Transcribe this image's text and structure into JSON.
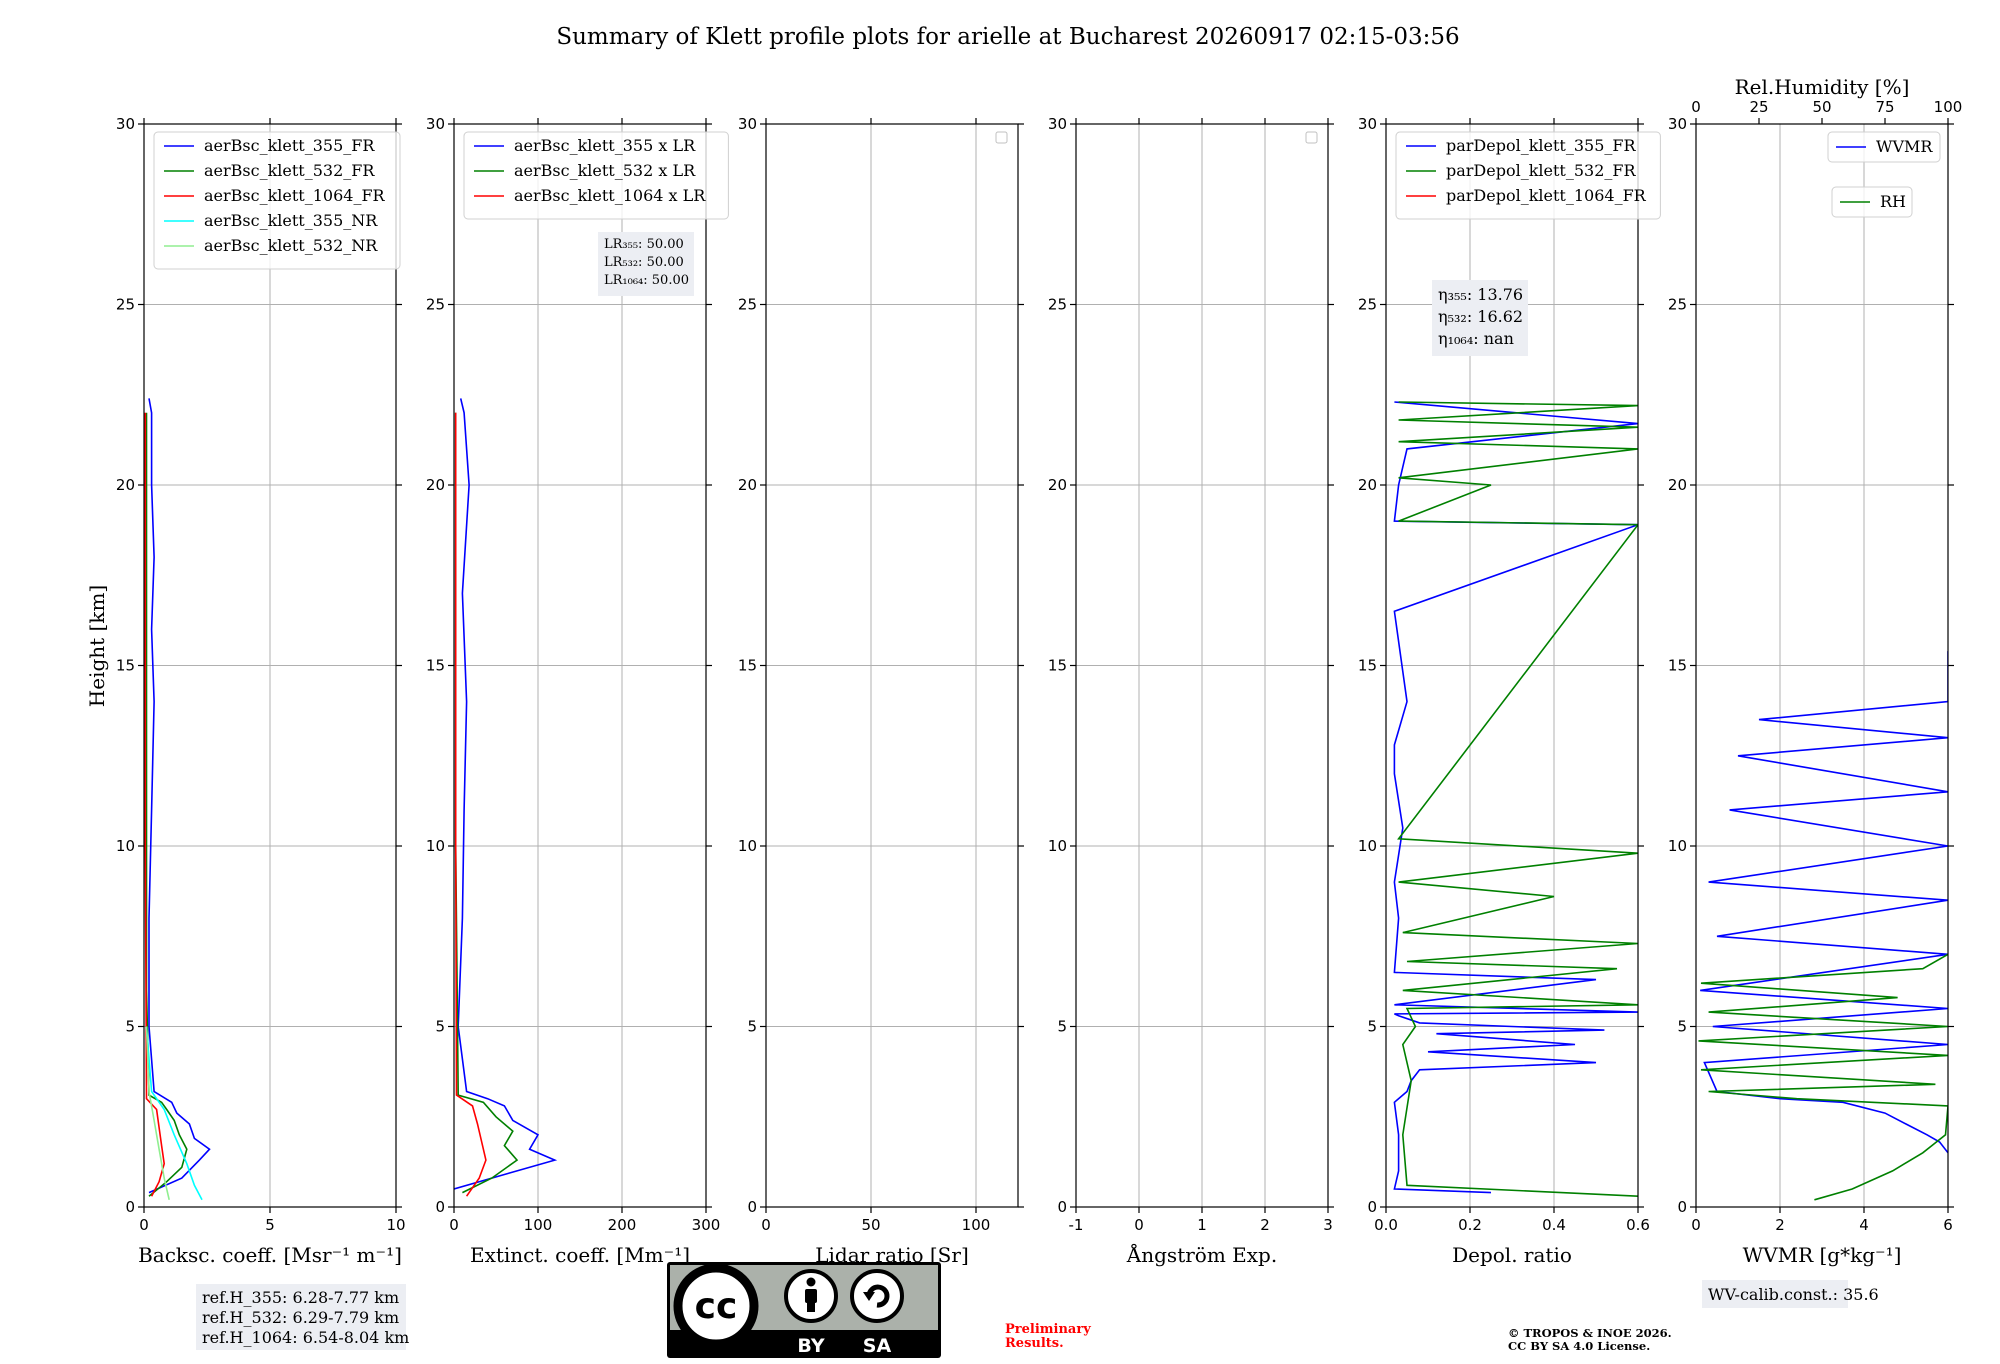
{
  "title": "Summary of Klett profile plots for arielle at Bucharest 20260917 02:15-03:56",
  "y_label": "Height [km]",
  "colors": {
    "blue": "#0000ff",
    "green": "#008000",
    "red": "#ff0000",
    "cyan": "#00ffff",
    "lightgreen": "#90ee90",
    "grid": "#b0b0b0",
    "annotation_bg": "#eceef3",
    "preliminary": "#ff0000"
  },
  "panels": [
    {
      "id": "backscatter",
      "xlabel": "Backsc. coeff. [Msr⁻¹ m⁻¹]",
      "xlim": [
        0,
        10
      ],
      "xticks": [
        0,
        5,
        10
      ],
      "legend": [
        "aerBsc_klett_355_FR",
        "aerBsc_klett_532_FR",
        "aerBsc_klett_1064_FR",
        "aerBsc_klett_355_NR",
        "aerBsc_klett_532_NR"
      ],
      "legend_colors": [
        "blue",
        "green",
        "red",
        "cyan",
        "lightgreen"
      ]
    },
    {
      "id": "extinction",
      "xlabel": "Extinct. coeff. [Mm⁻¹]",
      "xlim": [
        0,
        300
      ],
      "xticks": [
        0,
        100,
        200,
        300
      ],
      "legend": [
        "aerBsc_klett_355 x LR",
        "aerBsc_klett_532 x LR",
        "aerBsc_klett_1064 x LR"
      ],
      "legend_colors": [
        "blue",
        "green",
        "red"
      ],
      "annotation": [
        "LR₃₅₅: 50.00",
        "LR₅₃₂: 50.00",
        "LR₁₀₆₄: 50.00"
      ]
    },
    {
      "id": "lidar_ratio",
      "xlabel": "Lidar ratio [Sr]",
      "xlim": [
        0,
        120
      ],
      "xticks": [
        0,
        50,
        100
      ],
      "legend": []
    },
    {
      "id": "angstrom",
      "xlabel": "Ångström Exp.",
      "xlim": [
        -1,
        3
      ],
      "xticks": [
        -1,
        0,
        1,
        2,
        3
      ],
      "legend": []
    },
    {
      "id": "depol",
      "xlabel": "Depol. ratio",
      "xlim": [
        0,
        0.6
      ],
      "xticks": [
        0.0,
        0.2,
        0.4,
        0.6
      ],
      "tick_format": "0.0",
      "legend": [
        "parDepol_klett_355_FR",
        "parDepol_klett_532_FR",
        "parDepol_klett_1064_FR"
      ],
      "legend_colors": [
        "blue",
        "green",
        "red"
      ],
      "annotation": [
        "η₃₅₅: 13.76",
        "η₅₃₂: 16.62",
        "η₁₀₆₄: nan"
      ]
    },
    {
      "id": "wvmr",
      "xlabel": "WVMR [g*kg⁻¹]",
      "xlim": [
        0,
        6
      ],
      "xticks": [
        0,
        2,
        4,
        6
      ],
      "top_label": "Rel.Humidity [%]",
      "top_xlim": [
        0,
        100
      ],
      "top_xticks": [
        0,
        25,
        50,
        75,
        100
      ],
      "legend": [
        "WVMR",
        "RH"
      ],
      "legend_colors": [
        "blue",
        "green"
      ]
    }
  ],
  "y_axis": {
    "ylim": [
      0,
      30
    ],
    "yticks": [
      0,
      5,
      10,
      15,
      20,
      25,
      30
    ]
  },
  "chart_data": [
    {
      "type": "line",
      "title": "",
      "xlabel": "Backsc. coeff. [Msr⁻¹ m⁻¹]",
      "ylabel": "Height [km]",
      "xlim": [
        0,
        10
      ],
      "ylim": [
        0,
        30
      ],
      "grid": true,
      "legend_position": "top-left",
      "series": [
        {
          "name": "aerBsc_klett_355_FR",
          "color": "blue",
          "x": [
            0.2,
            1.5,
            2.2,
            2.6,
            2.0,
            1.8,
            1.3,
            1.1,
            0.4,
            0.2,
            0.2,
            0.3,
            0.4,
            0.3,
            0.4,
            0.3,
            0.3,
            0.2
          ],
          "y": [
            0.4,
            0.8,
            1.3,
            1.6,
            1.9,
            2.3,
            2.6,
            2.9,
            3.2,
            5,
            8,
            11,
            14,
            16,
            18,
            20,
            22,
            22.4
          ]
        },
        {
          "name": "aerBsc_klett_532_FR",
          "color": "green",
          "x": [
            0.2,
            0.9,
            1.5,
            1.7,
            1.4,
            1.2,
            0.9,
            0.7,
            0.2,
            0.1,
            0.1,
            0.1
          ],
          "y": [
            0.3,
            0.7,
            1.1,
            1.6,
            2.0,
            2.4,
            2.7,
            2.9,
            3.1,
            6,
            14,
            22
          ]
        },
        {
          "name": "aerBsc_klett_1064_FR",
          "color": "red",
          "x": [
            0.3,
            0.6,
            0.8,
            0.7,
            0.6,
            0.5,
            0.1,
            0.05,
            0.05
          ],
          "y": [
            0.3,
            0.7,
            1.2,
            1.7,
            2.2,
            2.7,
            3.0,
            10,
            22
          ]
        },
        {
          "name": "aerBsc_klett_355_NR",
          "color": "cyan",
          "x": [
            2.3,
            2.0,
            1.7,
            1.2,
            0.8,
            0.3,
            0.1
          ],
          "y": [
            0.2,
            0.6,
            1.2,
            2.0,
            2.7,
            3.2,
            5.0
          ]
        },
        {
          "name": "aerBsc_klett_532_NR",
          "color": "lightgreen",
          "x": [
            1.0,
            0.8,
            0.6,
            0.4,
            0.2,
            0.1
          ],
          "y": [
            0.2,
            0.8,
            1.6,
            2.4,
            3.2,
            5.0
          ]
        }
      ]
    },
    {
      "type": "line",
      "title": "",
      "xlabel": "Extinct. coeff. [Mm⁻¹]",
      "ylabel": "Height [km]",
      "xlim": [
        0,
        300
      ],
      "ylim": [
        0,
        30
      ],
      "grid": true,
      "legend_position": "top-left",
      "series": [
        {
          "name": "aerBsc_klett_355 x LR",
          "color": "blue",
          "x": [
            0,
            60,
            120,
            90,
            100,
            70,
            60,
            40,
            15,
            5,
            10,
            12,
            15,
            10,
            18,
            12,
            8
          ],
          "y": [
            0.5,
            0.9,
            1.3,
            1.6,
            2.0,
            2.4,
            2.8,
            3.0,
            3.2,
            5,
            8,
            11,
            14,
            17,
            20,
            22,
            22.4
          ]
        },
        {
          "name": "aerBsc_klett_532 x LR",
          "color": "green",
          "x": [
            10,
            45,
            75,
            60,
            70,
            50,
            35,
            5,
            2,
            2
          ],
          "y": [
            0.4,
            0.8,
            1.3,
            1.7,
            2.1,
            2.5,
            2.9,
            3.1,
            10,
            22
          ]
        },
        {
          "name": "aerBsc_klett_1064 x LR",
          "color": "red",
          "x": [
            15,
            30,
            38,
            33,
            28,
            22,
            3,
            2,
            2
          ],
          "y": [
            0.3,
            0.8,
            1.3,
            1.8,
            2.3,
            2.8,
            3.1,
            10,
            22
          ]
        }
      ]
    },
    {
      "type": "line",
      "title": "",
      "xlabel": "Lidar ratio [Sr]",
      "ylabel": "Height [km]",
      "xlim": [
        0,
        120
      ],
      "ylim": [
        0,
        30
      ],
      "grid": true,
      "legend_position": "top-right",
      "series": []
    },
    {
      "type": "line",
      "title": "",
      "xlabel": "Ångström Exp.",
      "ylabel": "Height [km]",
      "xlim": [
        -1,
        3
      ],
      "ylim": [
        0,
        30
      ],
      "grid": true,
      "legend_position": "top-right",
      "series": []
    },
    {
      "type": "line",
      "title": "",
      "xlabel": "Depol. ratio",
      "ylabel": "Height [km]",
      "xlim": [
        0,
        0.6
      ],
      "ylim": [
        0,
        30
      ],
      "grid": true,
      "legend_position": "top-left",
      "series": [
        {
          "name": "parDepol_klett_355_FR",
          "color": "blue",
          "x": [
            0.25,
            0.02,
            0.03,
            0.03,
            0.02,
            0.05,
            0.06,
            0.08,
            0.5,
            0.1,
            0.45,
            0.12,
            0.52,
            0.08,
            0.03,
            0.02,
            0.6,
            0.02,
            0.5,
            0.02,
            0.03,
            0.02,
            0.04,
            0.02,
            0.02,
            0.05,
            0.02,
            0.6,
            0.02,
            0.03,
            0.05,
            0.6,
            0.02
          ],
          "y": [
            0.4,
            0.5,
            1.0,
            2.0,
            2.9,
            3.2,
            3.5,
            3.8,
            4.0,
            4.3,
            4.5,
            4.8,
            4.9,
            5.1,
            5.3,
            5.35,
            5.4,
            5.6,
            6.3,
            6.5,
            8.0,
            9.0,
            10.5,
            12.0,
            12.8,
            14.0,
            16.5,
            18.9,
            19.0,
            20.0,
            21.0,
            21.7,
            22.3
          ]
        },
        {
          "name": "parDepol_klett_532_FR",
          "color": "green",
          "x": [
            0.6,
            0.05,
            0.04,
            0.06,
            0.04,
            0.07,
            0.05,
            0.6,
            0.04,
            0.55,
            0.05,
            0.6,
            0.04,
            0.4,
            0.03,
            0.6,
            0.03,
            0.6,
            0.03,
            0.25,
            0.03,
            0.6,
            0.03,
            0.6,
            0.03,
            0.6,
            0.03
          ],
          "y": [
            0.3,
            0.6,
            2.0,
            3.5,
            4.5,
            5.0,
            5.5,
            5.6,
            6.0,
            6.6,
            6.8,
            7.3,
            7.6,
            8.6,
            9.0,
            9.8,
            10.2,
            18.9,
            19.0,
            20.0,
            20.2,
            21.0,
            21.2,
            21.6,
            21.8,
            22.2,
            22.3
          ]
        }
      ]
    },
    {
      "type": "line",
      "title": "",
      "xlabel": "WVMR [g*kg⁻¹]",
      "ylabel": "Height [km]",
      "xlim": [
        0,
        6
      ],
      "ylim": [
        0,
        30
      ],
      "grid": true,
      "legend_position": "top-right",
      "series": [
        {
          "name": "WVMR",
          "color": "blue",
          "x": [
            6.0,
            5.8,
            5.5,
            5.0,
            4.5,
            3.5,
            2.0,
            0.5,
            0.2,
            6.0,
            0.4,
            6.0,
            0.1,
            6.0,
            0.5,
            6.0,
            0.3,
            6.0,
            0.8,
            6.0,
            1.0,
            6.0,
            1.5,
            6.0,
            6.0
          ],
          "y": [
            1.5,
            1.8,
            2.0,
            2.3,
            2.6,
            2.9,
            3.0,
            3.2,
            4.0,
            4.5,
            5.0,
            5.5,
            6.0,
            7.0,
            7.5,
            8.5,
            9.0,
            10.0,
            11.0,
            11.5,
            12.5,
            13.0,
            13.5,
            14.0,
            15.4
          ]
        },
        {
          "name": "RH",
          "color": "green",
          "x": [
            47,
            62,
            78,
            90,
            99,
            100,
            40,
            5,
            95,
            2,
            100,
            1,
            100,
            5,
            80,
            2,
            90,
            100
          ],
          "y": [
            0.2,
            0.5,
            1.0,
            1.5,
            2.0,
            2.8,
            3.0,
            3.2,
            3.4,
            3.8,
            4.2,
            4.6,
            5.0,
            5.4,
            5.8,
            6.2,
            6.6,
            7.0
          ]
        }
      ]
    }
  ],
  "footer": {
    "ref_heights": [
      "ref.H_355: 6.28-7.77 km",
      "ref.H_532: 6.29-7.79 km",
      "ref.H_1064: 6.54-8.04 km"
    ],
    "wv_calib": "WV-calib.const.: 35.6",
    "preliminary": [
      "Preliminary",
      "Results."
    ],
    "copyright": [
      "© TROPOS & INOE 2026.",
      "CC BY SA 4.0 License."
    ],
    "license_badge": {
      "icon": "cc-by-sa-badge",
      "left_text": "BY",
      "right_text": "SA",
      "logo_text": "cc"
    }
  }
}
